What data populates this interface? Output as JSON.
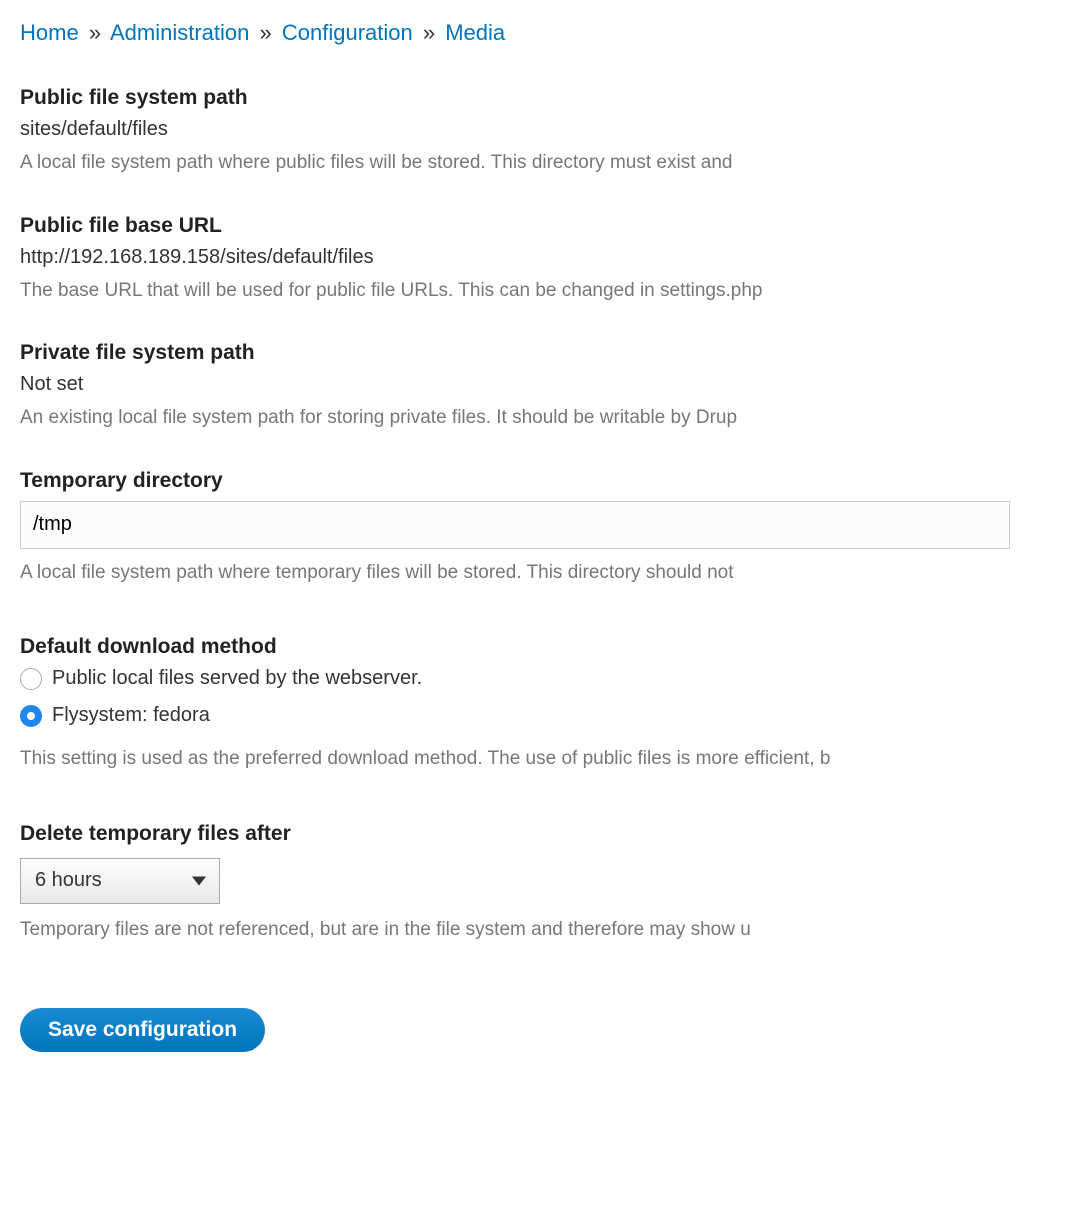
{
  "breadcrumb": {
    "items": [
      "Home",
      "Administration",
      "Configuration",
      "Media"
    ],
    "separator": "»"
  },
  "fields": {
    "public_path": {
      "label": "Public file system path",
      "value": "sites/default/files",
      "description": "A local file system path where public files will be stored. This directory must exist and "
    },
    "public_url": {
      "label": "Public file base URL",
      "value": "http://192.168.189.158/sites/default/files",
      "description": "The base URL that will be used for public file URLs. This can be changed in settings.php"
    },
    "private_path": {
      "label": "Private file system path",
      "value": "Not set",
      "description": "An existing local file system path for storing private files. It should be writable by Drup"
    },
    "temp_dir": {
      "label": "Temporary directory",
      "value": "/tmp",
      "description": "A local file system path where temporary files will be stored. This directory should not "
    },
    "download_method": {
      "label": "Default download method",
      "options": [
        {
          "label": "Public local files served by the webserver.",
          "selected": false
        },
        {
          "label": "Flysystem: fedora",
          "selected": true
        }
      ],
      "description": "This setting is used as the preferred download method. The use of public files is more efficient, b"
    },
    "delete_temp": {
      "label": "Delete temporary files after",
      "selected": "6 hours",
      "description": "Temporary files are not referenced, but are in the file system and therefore may show u"
    }
  },
  "save_button": "Save configuration"
}
